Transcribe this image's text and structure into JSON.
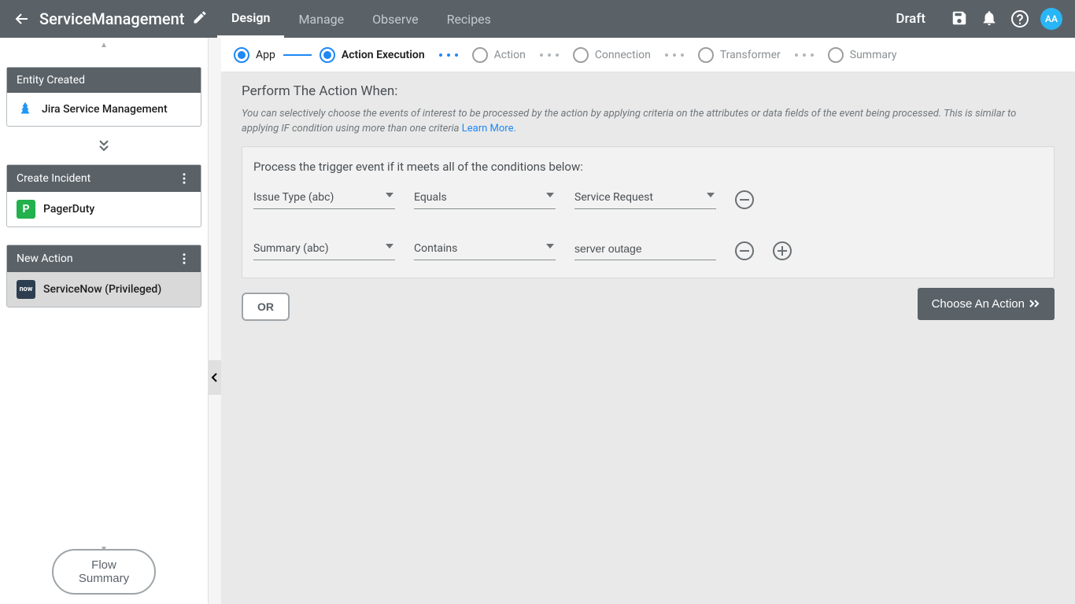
{
  "topbar": {
    "title": "ServiceManagement",
    "tabs": [
      "Design",
      "Manage",
      "Observe",
      "Recipes"
    ],
    "active_tab": 0,
    "status": "Draft",
    "avatar": "AA"
  },
  "sidebar": {
    "cards": [
      {
        "header": "Entity Created",
        "app": "Jira Service Management",
        "has_menu": false,
        "icon_type": "jira"
      },
      {
        "header": "Create Incident",
        "app": "PagerDuty",
        "has_menu": true,
        "icon_type": "pd"
      },
      {
        "header": "New Action",
        "app": "ServiceNow (Privileged)",
        "has_menu": true,
        "icon_type": "snow",
        "highlight": true
      }
    ],
    "flow_summary": "Flow Summary"
  },
  "stepper": {
    "steps": [
      "App",
      "Action Execution",
      "Action",
      "Connection",
      "Transformer",
      "Summary"
    ],
    "completed_index": 0,
    "active_index": 1
  },
  "panel": {
    "heading": "Perform The Action When:",
    "helper_text": "You can selectively choose the events of interest to be processed by the action by applying criteria on the attributes or data fields of the event being processed. This is similar to applying IF condition using more than one criteria  ",
    "learn_more": "Learn More.",
    "cond_title": "Process the trigger event if it meets all of the conditions below:",
    "rows": [
      {
        "attribute": "Issue Type (abc)",
        "operator": "Equals",
        "value": "Service Request",
        "value_is_dropdown": true,
        "can_add": false
      },
      {
        "attribute": "Summary (abc)",
        "operator": "Contains",
        "value": "server outage",
        "value_is_dropdown": false,
        "can_add": true
      }
    ],
    "or_label": "OR",
    "choose_action": "Choose An Action"
  }
}
